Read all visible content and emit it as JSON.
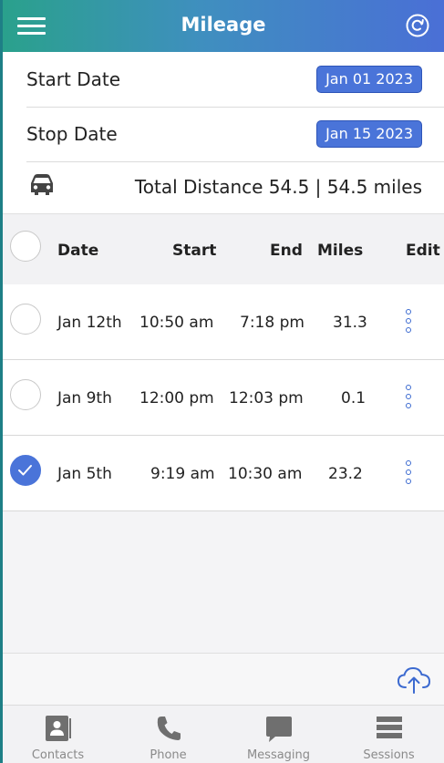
{
  "header": {
    "title": "Mileage",
    "menu_icon": "hamburger-menu-icon",
    "refresh_icon": "refresh-icon"
  },
  "dates": {
    "start_label": "Start Date",
    "start_value": "Jan 01 2023",
    "stop_label": "Stop Date",
    "stop_value": "Jan 15 2023"
  },
  "summary": {
    "icon": "car-icon",
    "total_text": "Total Distance 54.5 | 54.5 miles"
  },
  "table": {
    "headers": {
      "date": "Date",
      "start": "Start",
      "end": "End",
      "miles": "Miles",
      "edit": "Edit"
    },
    "rows": [
      {
        "date": "Jan 12th",
        "start": "10:50 am",
        "end": "7:18 pm",
        "miles": "31.3",
        "selected": false
      },
      {
        "date": "Jan 9th",
        "start": "12:00 pm",
        "end": "12:03 pm",
        "miles": "0.1",
        "selected": false
      },
      {
        "date": "Jan 5th",
        "start": "9:19 am",
        "end": "10:30 am",
        "miles": "23.2",
        "selected": true
      }
    ]
  },
  "upload_icon": "cloud-upload-icon",
  "nav": {
    "items": [
      {
        "label": "Contacts",
        "icon": "contacts-icon"
      },
      {
        "label": "Phone",
        "icon": "phone-icon"
      },
      {
        "label": "Messaging",
        "icon": "messaging-icon"
      },
      {
        "label": "Sessions",
        "icon": "sessions-icon"
      }
    ]
  },
  "colors": {
    "accent": "#4a74d9",
    "header_start": "#2aa18c",
    "header_end": "#4a6fd6"
  }
}
